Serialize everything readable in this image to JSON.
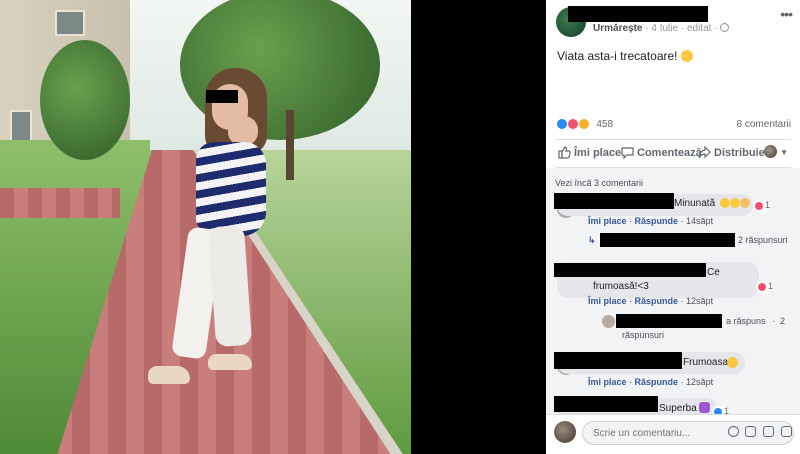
{
  "post": {
    "follow_label": "Urmărește",
    "date": "4 Iulie",
    "edited": "editat",
    "text": "Viata asta-i trecatoare!",
    "more": "•••"
  },
  "reactions": {
    "count": "458",
    "comments_count": "8 comentarii"
  },
  "actions": {
    "like": "Îmi place",
    "comment": "Comentează",
    "share": "Distribuie"
  },
  "comments": {
    "see_more": "Vezi încă 3 comentarii",
    "items": [
      {
        "text": "Minunată",
        "reaction_count": "1",
        "like": "Îmi place",
        "reply": "Răspunde",
        "time": "14săpt",
        "replies": "2 răspunsuri"
      },
      {
        "text_line1": "Ce",
        "text_line2": "frumoasă!<3",
        "reaction_count": "1",
        "like": "Îmi place",
        "reply": "Răspunde",
        "time": "12săpt",
        "replies_prefix": "a răspuns",
        "replies_count": "2",
        "replies_suffix": "răspunsuri"
      },
      {
        "text": "Frumoasa",
        "like": "Îmi place",
        "reply": "Răspunde",
        "time": "12săpt"
      },
      {
        "text": "Superba",
        "reaction_count": "1"
      }
    ]
  },
  "comment_box": {
    "placeholder": "Scrie un comentariu..."
  },
  "colors": {
    "link": "#385898",
    "like_blue": "#2d88ff",
    "love_red": "#f0506e",
    "wow_yellow": "#f7b125"
  }
}
